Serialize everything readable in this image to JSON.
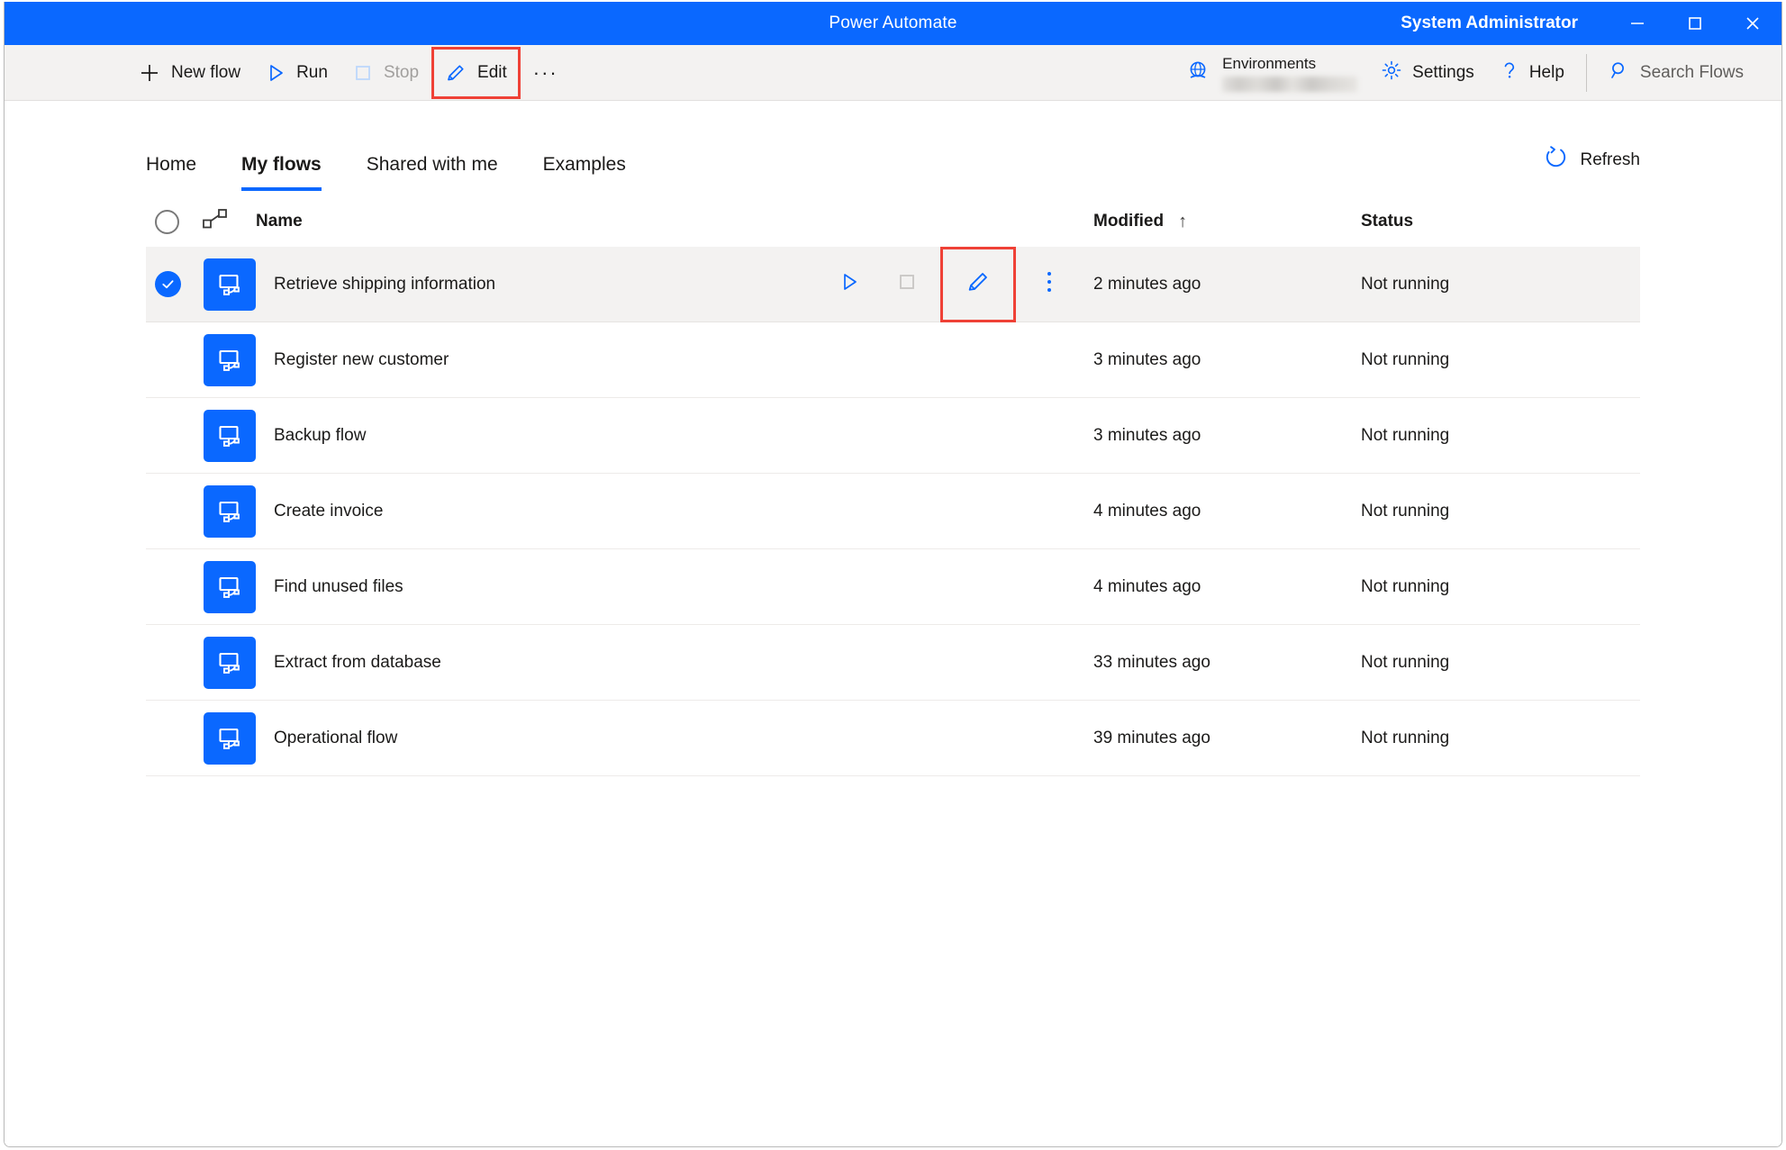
{
  "window": {
    "title": "Power Automate",
    "user": "System Administrator",
    "controls": [
      {
        "name": "minimize",
        "icon": "minimize-icon"
      },
      {
        "name": "maximize",
        "icon": "maximize-icon"
      },
      {
        "name": "close",
        "icon": "close-icon"
      }
    ]
  },
  "commandbar": {
    "items": [
      {
        "label": "New flow",
        "icon": "plus-icon",
        "state": "enabled",
        "highlighted": false
      },
      {
        "label": "Run",
        "icon": "play-icon",
        "state": "enabled",
        "highlighted": false
      },
      {
        "label": "Stop",
        "icon": "stop-icon",
        "state": "disabled",
        "highlighted": false
      },
      {
        "label": "Edit",
        "icon": "pencil-icon",
        "state": "enabled",
        "highlighted": true
      }
    ],
    "overflow_label": "···",
    "environments": {
      "label": "Environments",
      "icon": "globe-icon",
      "value": ""
    },
    "settings_label": "Settings",
    "help_label": "Help",
    "search_placeholder": "Search Flows"
  },
  "tabs": [
    {
      "label": "Home",
      "active": false
    },
    {
      "label": "My flows",
      "active": true
    },
    {
      "label": "Shared with me",
      "active": false
    },
    {
      "label": "Examples",
      "active": false
    }
  ],
  "refresh_label": "Refresh",
  "table": {
    "headers": {
      "select_all": "",
      "type": "",
      "name": "Name",
      "modified": "Modified",
      "sort_indicator": "↑",
      "status": "Status"
    },
    "rows": [
      {
        "name": "Retrieve shipping information",
        "modified": "2 minutes ago",
        "status": "Not running",
        "selected": true
      },
      {
        "name": "Register new customer",
        "modified": "3 minutes ago",
        "status": "Not running",
        "selected": false
      },
      {
        "name": "Backup flow",
        "modified": "3 minutes ago",
        "status": "Not running",
        "selected": false
      },
      {
        "name": "Create invoice",
        "modified": "4 minutes ago",
        "status": "Not running",
        "selected": false
      },
      {
        "name": "Find unused files",
        "modified": "4 minutes ago",
        "status": "Not running",
        "selected": false
      },
      {
        "name": "Extract from database",
        "modified": "33 minutes ago",
        "status": "Not running",
        "selected": false
      },
      {
        "name": "Operational flow",
        "modified": "39 minutes ago",
        "status": "Not running",
        "selected": false
      }
    ],
    "row_actions": [
      {
        "name": "run-flow",
        "icon": "play-icon",
        "state": "enabled",
        "highlighted": false
      },
      {
        "name": "stop-flow",
        "icon": "stop-icon",
        "state": "disabled",
        "highlighted": false
      },
      {
        "name": "edit-flow",
        "icon": "pencil-icon",
        "state": "enabled",
        "highlighted": true
      },
      {
        "name": "more-options",
        "icon": "kebab-menu-icon",
        "state": "enabled",
        "highlighted": false
      }
    ]
  },
  "colors": {
    "accent": "#0a68ff",
    "titlebar": "#0a68ff",
    "commandbar_bg": "#f3f2f1",
    "selected_row_bg": "#f3f2f1",
    "highlight_box": "#ef4136",
    "disabled_text": "#a19f9d",
    "text": "#1b1a19"
  }
}
